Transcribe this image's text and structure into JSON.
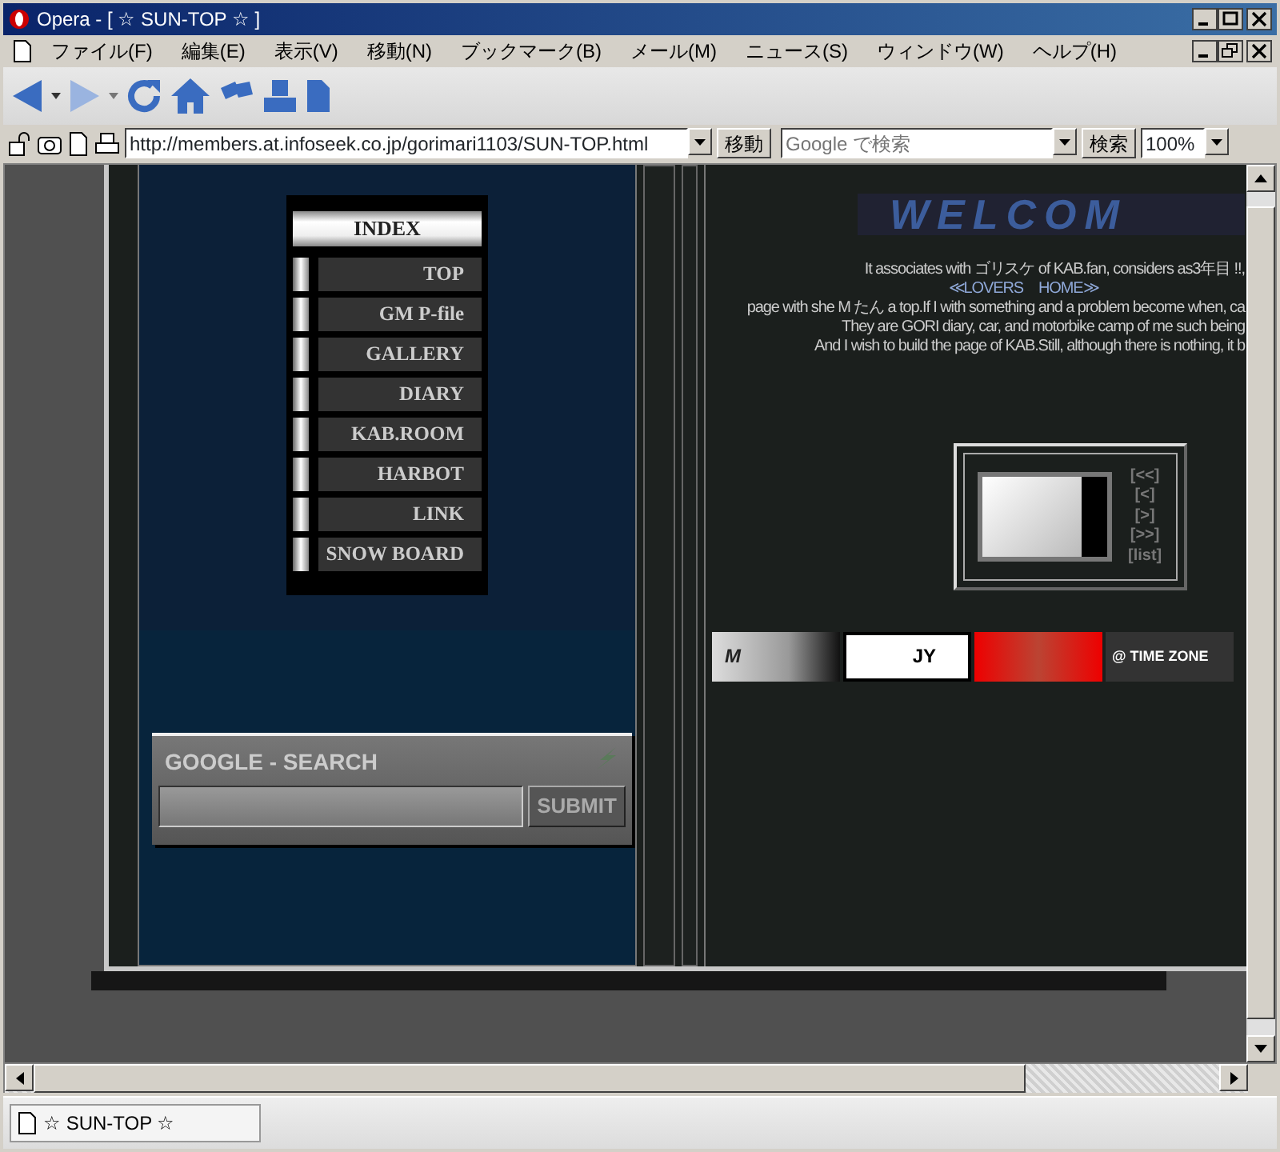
{
  "window": {
    "title": "Opera - [ ☆ SUN-TOP ☆ ]"
  },
  "menu": [
    "ファイル(F)",
    "編集(E)",
    "表示(V)",
    "移動(N)",
    "ブックマーク(B)",
    "メール(M)",
    "ニュース(S)",
    "ウィンドウ(W)",
    "ヘルプ(H)"
  ],
  "address_bar": {
    "url": "http://members.at.infoseek.co.jp/gorimari1103/SUN-TOP.html",
    "go_button": "移動",
    "search_placeholder": "Google で検索",
    "search_button": "検索",
    "zoom": "100%"
  },
  "page": {
    "index_title": "INDEX",
    "nav": [
      "TOP",
      "GM P-file",
      "GALLERY",
      "DIARY",
      "KAB.ROOM",
      "HARBOT",
      "LINK",
      "SNOW BOARD"
    ],
    "google_search": {
      "title": "GOOGLE - SEARCH",
      "button": "SUBMIT"
    },
    "welcome": "WELCOM",
    "intro": [
      {
        "kind": "text",
        "text": "It associates with ゴリスケ of KAB.fan, considers as3年目 !!,"
      },
      {
        "kind": "link",
        "text": "≪LOVERS　HOME≫"
      },
      {
        "kind": "text",
        "text": "page with she M たん a top.If I with something and a problem become when, ca"
      },
      {
        "kind": "text",
        "text": "They are GORI diary, car, and motorbike camp of me such being"
      },
      {
        "kind": "text",
        "text": "And I wish to build the page of KAB.Still, although there is nothing, it b"
      }
    ],
    "slideshow": {
      "controls": [
        "[<<]",
        "[<]",
        "[>]",
        "[>>]",
        "[list]"
      ]
    },
    "banners": [
      {
        "kind": "light",
        "text": "M"
      },
      {
        "kind": "white",
        "text": "JY"
      },
      {
        "kind": "red"
      },
      {
        "kind": "dark",
        "text": "@ TIME ZONE"
      }
    ]
  },
  "tabs": [
    {
      "label": "☆ SUN-TOP ☆",
      "selected": true
    }
  ]
}
